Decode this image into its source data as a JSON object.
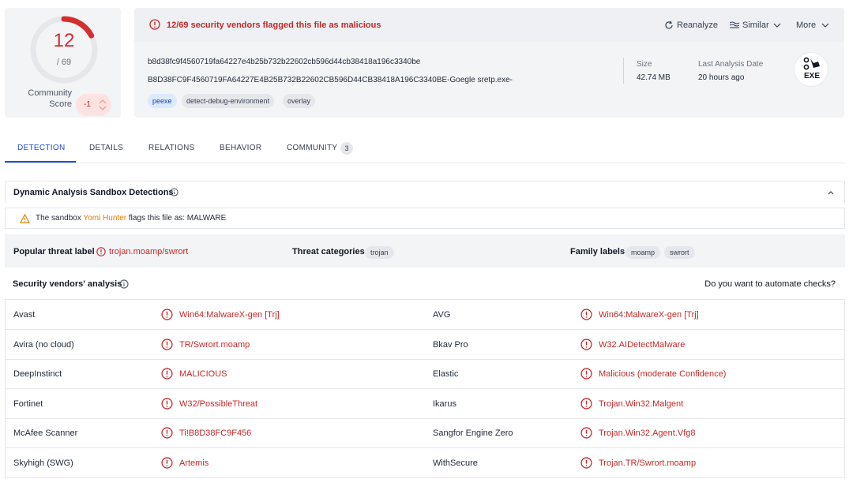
{
  "score": {
    "detections": "12",
    "total": "/ 69",
    "detected_fraction": 0.174,
    "community_label_line1": "Community",
    "community_label_line2": "Score",
    "community_value": "-1"
  },
  "alert": {
    "text": "12/69 security vendors flagged this file as malicious"
  },
  "actions": {
    "reanalyze": "Reanalyze",
    "similar": "Similar",
    "more": "More"
  },
  "file": {
    "sha256": "b8d38fc9f4560719fa64227e4b25b732b22602cb596d44cb38418a196c3340be",
    "name": "B8D38FC9F4560719FA64227E4B25B732B22602CB596D44CB38418A196C3340BE-Goegle sretp.exe-",
    "tags": [
      "peexe",
      "detect-debug-environment",
      "overlay"
    ],
    "size_label": "Size",
    "size_value": "42.74 MB",
    "last_analysis_label": "Last Analysis Date",
    "last_analysis_value": "20 hours ago",
    "type_badge": "EXE"
  },
  "tabs": [
    {
      "label": "DETECTION",
      "active": true
    },
    {
      "label": "DETAILS",
      "active": false
    },
    {
      "label": "RELATIONS",
      "active": false
    },
    {
      "label": "BEHAVIOR",
      "active": false
    },
    {
      "label": "COMMUNITY",
      "active": false,
      "count": "3"
    }
  ],
  "sandbox": {
    "title": "Dynamic Analysis Sandbox Detections",
    "prefix": "The sandbox",
    "sandbox_name": "Yomi Hunter",
    "suffix": "flags this file as: MALWARE"
  },
  "threat": {
    "popular_label": "Popular threat label",
    "popular_value": "trojan.moamp/swrort",
    "categories_label": "Threat categories",
    "categories": [
      "trojan"
    ],
    "family_label": "Family labels",
    "families": [
      "moamp",
      "swrort"
    ]
  },
  "vendors": {
    "title": "Security vendors' analysis",
    "automate_text": "Do you want to automate checks?",
    "rows": [
      {
        "left_name": "Avast",
        "left_result": "Win64:MalwareX-gen [Trj]",
        "right_name": "AVG",
        "right_result": "Win64:MalwareX-gen [Trj]"
      },
      {
        "left_name": "Avira (no cloud)",
        "left_result": "TR/Swrort.moamp",
        "right_name": "Bkav Pro",
        "right_result": "W32.AIDetectMalware"
      },
      {
        "left_name": "DeepInstinct",
        "left_result": "MALICIOUS",
        "right_name": "Elastic",
        "right_result": "Malicious (moderate Confidence)"
      },
      {
        "left_name": "Fortinet",
        "left_result": "W32/PossibleThreat",
        "right_name": "Ikarus",
        "right_result": "Trojan.Win32.Malgent"
      },
      {
        "left_name": "McAfee Scanner",
        "left_result": "Ti!B8D38FC9F456",
        "right_name": "Sangfor Engine Zero",
        "right_result": "Trojan.Win32.Agent.Vfg8"
      },
      {
        "left_name": "Skyhigh (SWG)",
        "left_result": "Artemis",
        "right_name": "WithSecure",
        "right_result": "Trojan.TR/Swrort.moamp"
      }
    ]
  },
  "colors": {
    "danger": "#d32f2f",
    "accent": "#1d4ed8",
    "warning": "#e67e00"
  }
}
